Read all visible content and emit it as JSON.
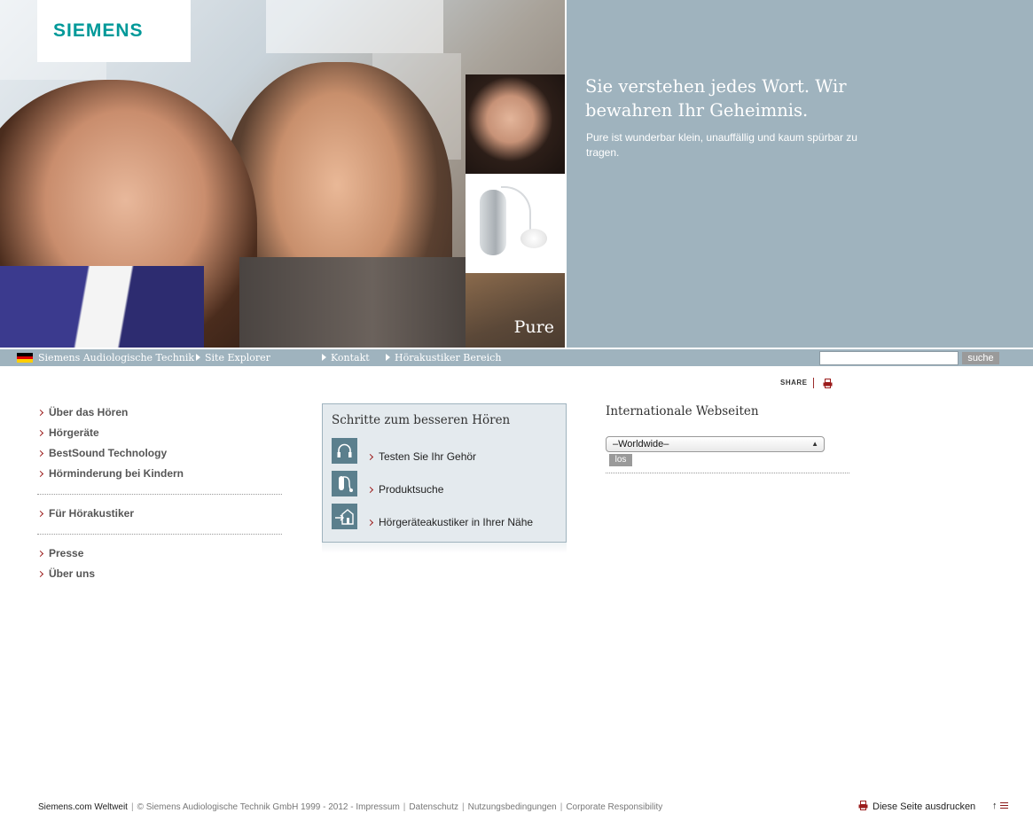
{
  "brand": {
    "logo": "SIEMENS"
  },
  "hero": {
    "headline": "Sie verstehen jedes Wort. Wir bewahren Ihr Geheimnis.",
    "subline": "Pure ist wunderbar klein, unauffällig und kaum spürbar zu tragen.",
    "product_label": "Pure"
  },
  "topnav": {
    "items": [
      {
        "label": "Siemens Audiologische Technik"
      },
      {
        "label": "Site Explorer"
      },
      {
        "label": "Kontakt"
      },
      {
        "label": "Hörakustiker Bereich"
      }
    ],
    "search": {
      "value": "",
      "button": "suche"
    }
  },
  "share": {
    "label": "SHARE"
  },
  "left_nav": {
    "group1": [
      "Über das Hören",
      "Hörgeräte",
      "BestSound Technology",
      "Hörminderung bei Kindern"
    ],
    "group2": [
      "Für Hörakustiker"
    ],
    "group3": [
      "Presse",
      "Über uns"
    ]
  },
  "steps": {
    "title": "Schritte zum besseren Hören",
    "items": [
      {
        "label": "Testen Sie Ihr Gehör",
        "icon": "headphones-icon"
      },
      {
        "label": "Produktsuche",
        "icon": "hearing-aid-icon"
      },
      {
        "label": "Hörgeräteakustiker in Ihrer Nähe",
        "icon": "location-house-icon"
      }
    ]
  },
  "international": {
    "title": "Internationale Webseiten",
    "selected": "–Worldwide–",
    "button": "los"
  },
  "footer": {
    "worldwide": "Siemens.com Weltweit",
    "copyright": "© Siemens Audiologische Technik GmbH 1999 - 2012 - Impressum",
    "links": [
      "Datenschutz",
      "Nutzungsbedingungen",
      "Corporate Responsibility"
    ],
    "print": "Diese Seite ausdrucken"
  },
  "colors": {
    "accent": "#009999",
    "panel": "#9fb3be",
    "chevron": "#9b1c1c",
    "step_icon": "#5b7f8d"
  }
}
